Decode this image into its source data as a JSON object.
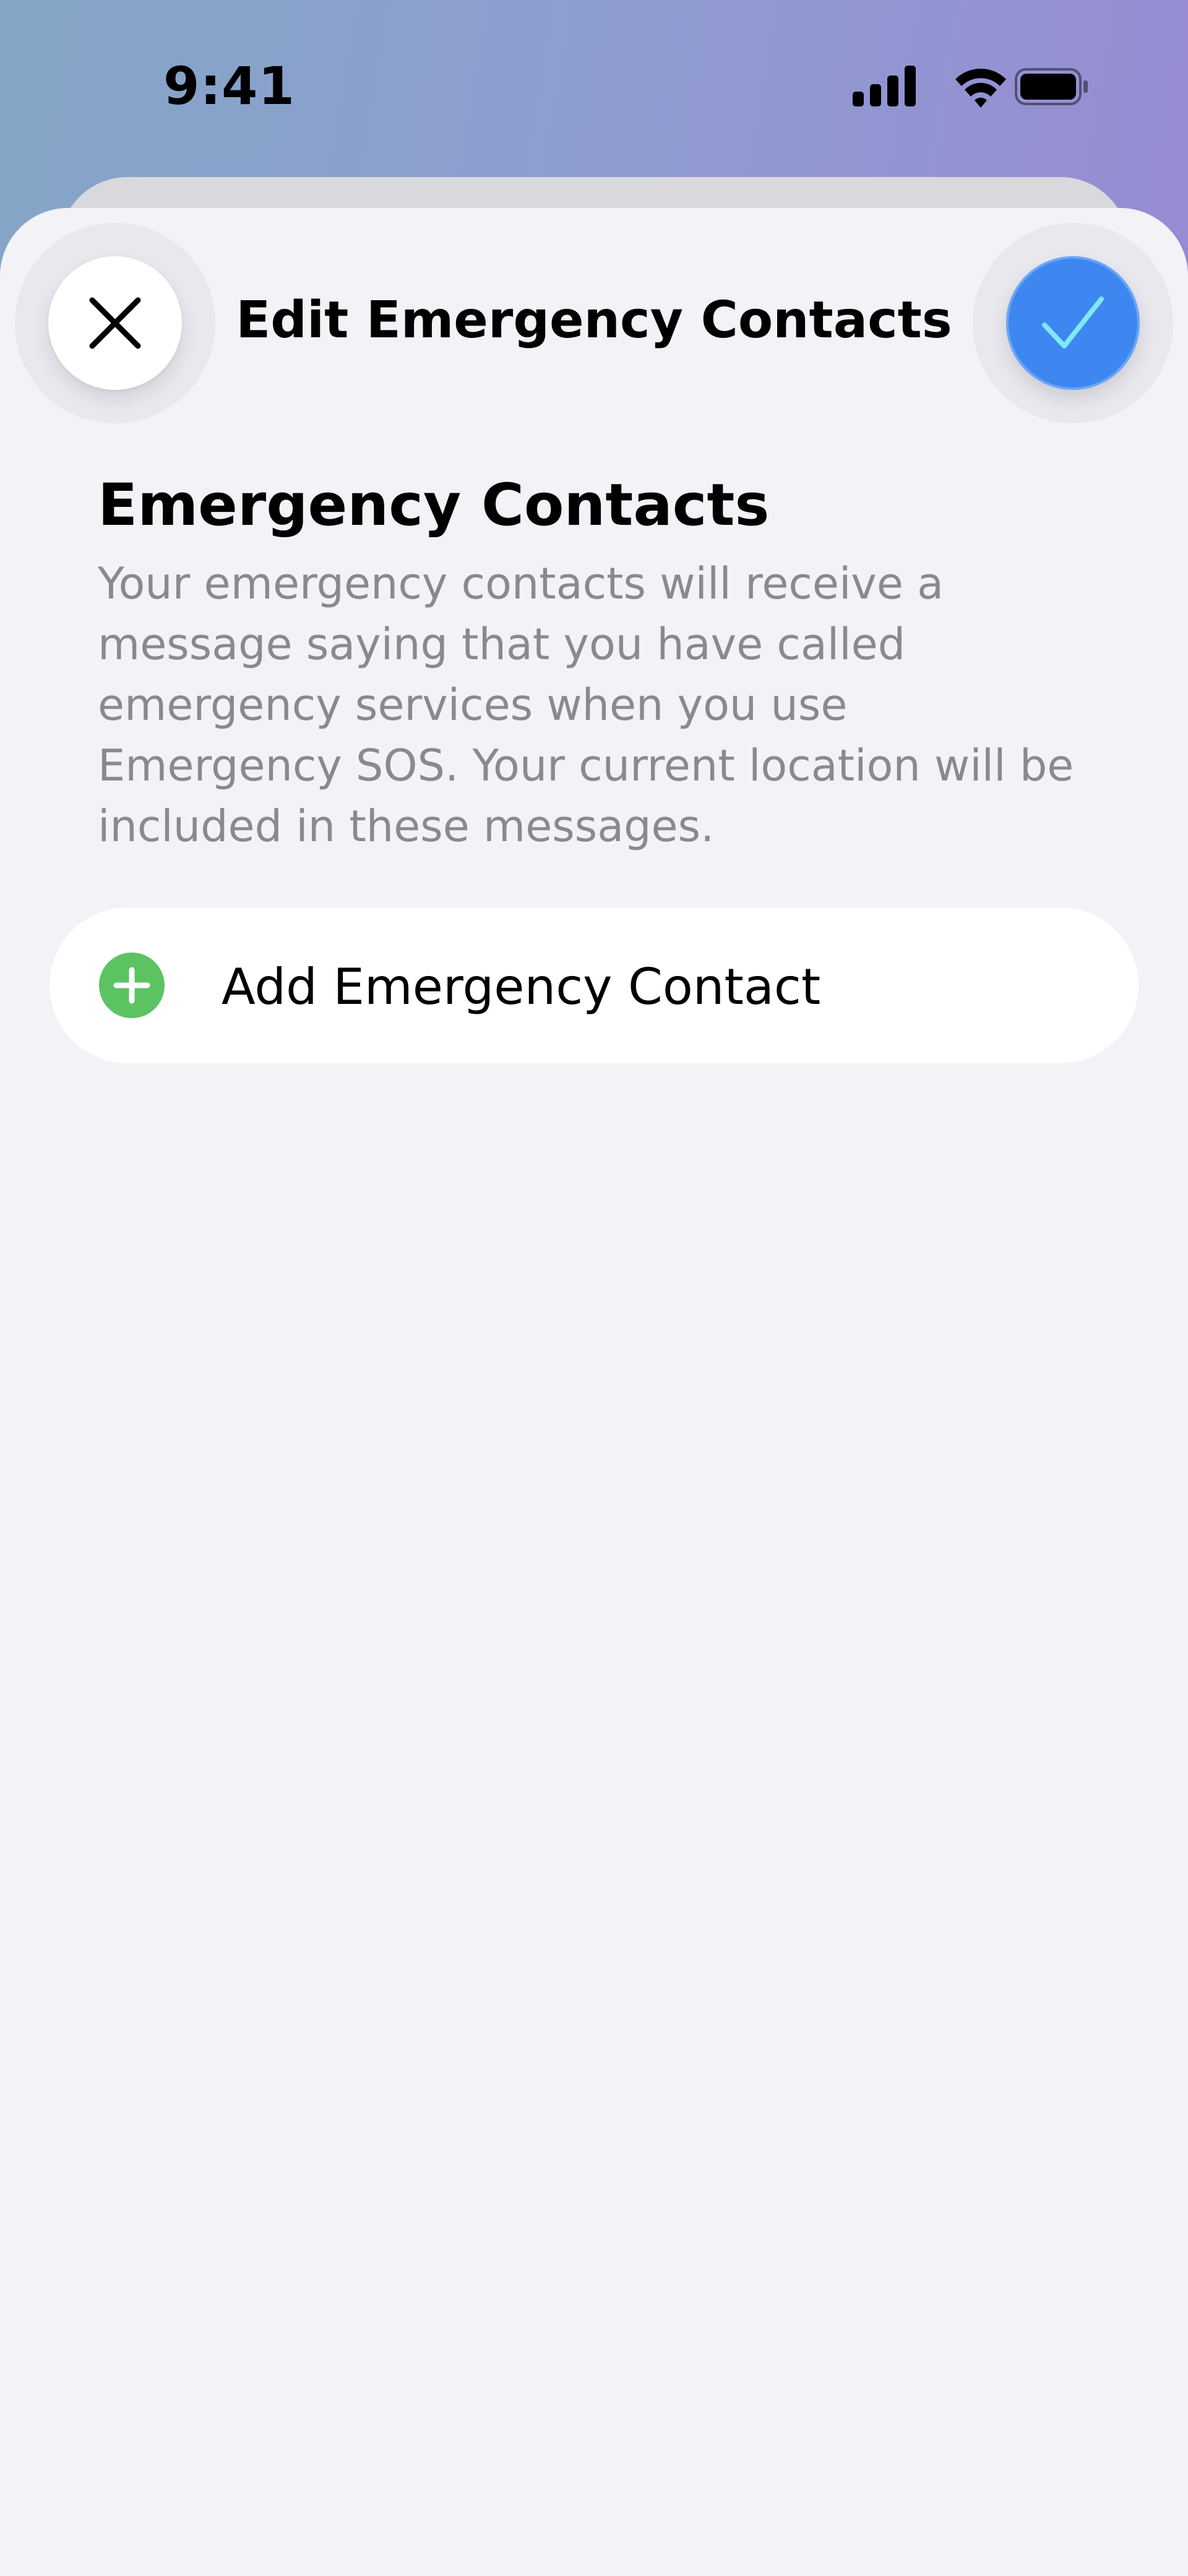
{
  "status_bar": {
    "time": "9:41",
    "icons": [
      "cellular-signal-icon",
      "wifi-icon",
      "battery-icon"
    ]
  },
  "nav": {
    "title": "Edit Emergency Contacts",
    "close_icon": "close-icon",
    "done_icon": "checkmark-icon"
  },
  "section": {
    "title": "Emergency Contacts",
    "description": "Your emergency contacts will receive a message saying that you have called emergency services when you use Emergency SOS. Your current location will be included in these messages."
  },
  "add_contact": {
    "label": "Add Emergency Contact",
    "icon": "plus-circle-icon"
  },
  "colors": {
    "accent": "#3f87f0",
    "add": "#5cc363",
    "background": "#f2f2f7",
    "secondary_text": "#8a8a8e"
  }
}
